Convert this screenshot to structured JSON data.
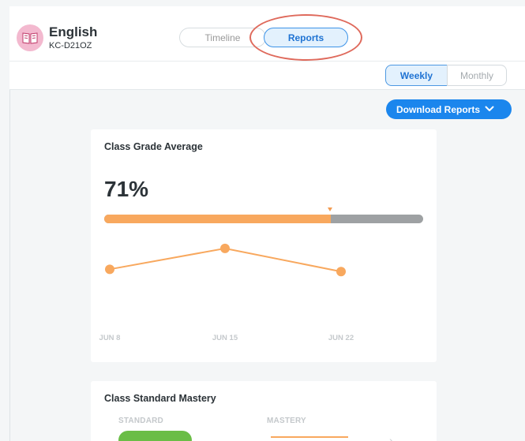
{
  "header": {
    "class_title": "English",
    "class_code": "KC-D21OZ",
    "tabs": [
      {
        "label": "Timeline",
        "active": false
      },
      {
        "label": "Reports",
        "active": true
      }
    ]
  },
  "period_toggle": {
    "options": [
      "Weekly",
      "Monthly"
    ],
    "selected": "Weekly"
  },
  "download_button": {
    "label": "Download Reports",
    "icon": "chevron-down-icon"
  },
  "grade_card": {
    "title": "Class Grade Average",
    "value_text": "71%",
    "progress": 0.71
  },
  "chart_data": {
    "type": "line",
    "categories": [
      "JUN 8",
      "JUN 15",
      "JUN 22"
    ],
    "series": [
      {
        "values": [
          0.66,
          0.93,
          0.63
        ]
      }
    ],
    "xlabel": "",
    "ylabel": "",
    "grid": false
  },
  "mastery_card": {
    "title": "Class Standard Mastery",
    "col_standard": "STANDARD",
    "col_mastery": "MASTERY"
  },
  "colors": {
    "accent": "#1b86ed",
    "chart_orange": "#f8a85e",
    "track_gray": "#9ea1a3",
    "annotation_red": "#df6a5c",
    "icon_pink": "#f3b9cf"
  }
}
